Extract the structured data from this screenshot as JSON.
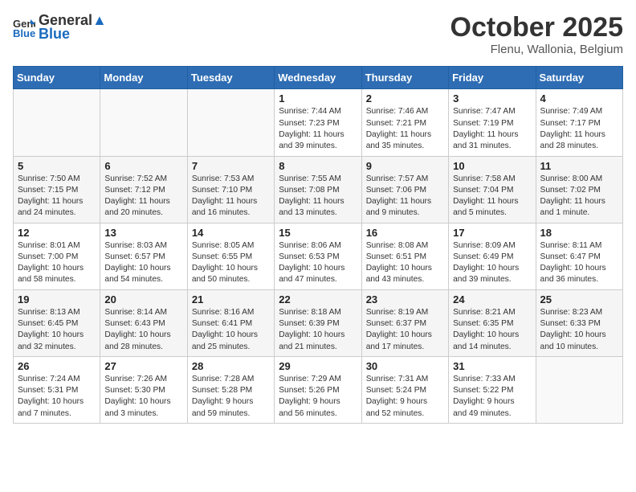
{
  "header": {
    "logo_general": "General",
    "logo_blue": "Blue",
    "month": "October 2025",
    "location": "Flenu, Wallonia, Belgium"
  },
  "weekdays": [
    "Sunday",
    "Monday",
    "Tuesday",
    "Wednesday",
    "Thursday",
    "Friday",
    "Saturday"
  ],
  "weeks": [
    [
      {
        "day": "",
        "info": ""
      },
      {
        "day": "",
        "info": ""
      },
      {
        "day": "",
        "info": ""
      },
      {
        "day": "1",
        "info": "Sunrise: 7:44 AM\nSunset: 7:23 PM\nDaylight: 11 hours\nand 39 minutes."
      },
      {
        "day": "2",
        "info": "Sunrise: 7:46 AM\nSunset: 7:21 PM\nDaylight: 11 hours\nand 35 minutes."
      },
      {
        "day": "3",
        "info": "Sunrise: 7:47 AM\nSunset: 7:19 PM\nDaylight: 11 hours\nand 31 minutes."
      },
      {
        "day": "4",
        "info": "Sunrise: 7:49 AM\nSunset: 7:17 PM\nDaylight: 11 hours\nand 28 minutes."
      }
    ],
    [
      {
        "day": "5",
        "info": "Sunrise: 7:50 AM\nSunset: 7:15 PM\nDaylight: 11 hours\nand 24 minutes."
      },
      {
        "day": "6",
        "info": "Sunrise: 7:52 AM\nSunset: 7:12 PM\nDaylight: 11 hours\nand 20 minutes."
      },
      {
        "day": "7",
        "info": "Sunrise: 7:53 AM\nSunset: 7:10 PM\nDaylight: 11 hours\nand 16 minutes."
      },
      {
        "day": "8",
        "info": "Sunrise: 7:55 AM\nSunset: 7:08 PM\nDaylight: 11 hours\nand 13 minutes."
      },
      {
        "day": "9",
        "info": "Sunrise: 7:57 AM\nSunset: 7:06 PM\nDaylight: 11 hours\nand 9 minutes."
      },
      {
        "day": "10",
        "info": "Sunrise: 7:58 AM\nSunset: 7:04 PM\nDaylight: 11 hours\nand 5 minutes."
      },
      {
        "day": "11",
        "info": "Sunrise: 8:00 AM\nSunset: 7:02 PM\nDaylight: 11 hours\nand 1 minute."
      }
    ],
    [
      {
        "day": "12",
        "info": "Sunrise: 8:01 AM\nSunset: 7:00 PM\nDaylight: 10 hours\nand 58 minutes."
      },
      {
        "day": "13",
        "info": "Sunrise: 8:03 AM\nSunset: 6:57 PM\nDaylight: 10 hours\nand 54 minutes."
      },
      {
        "day": "14",
        "info": "Sunrise: 8:05 AM\nSunset: 6:55 PM\nDaylight: 10 hours\nand 50 minutes."
      },
      {
        "day": "15",
        "info": "Sunrise: 8:06 AM\nSunset: 6:53 PM\nDaylight: 10 hours\nand 47 minutes."
      },
      {
        "day": "16",
        "info": "Sunrise: 8:08 AM\nSunset: 6:51 PM\nDaylight: 10 hours\nand 43 minutes."
      },
      {
        "day": "17",
        "info": "Sunrise: 8:09 AM\nSunset: 6:49 PM\nDaylight: 10 hours\nand 39 minutes."
      },
      {
        "day": "18",
        "info": "Sunrise: 8:11 AM\nSunset: 6:47 PM\nDaylight: 10 hours\nand 36 minutes."
      }
    ],
    [
      {
        "day": "19",
        "info": "Sunrise: 8:13 AM\nSunset: 6:45 PM\nDaylight: 10 hours\nand 32 minutes."
      },
      {
        "day": "20",
        "info": "Sunrise: 8:14 AM\nSunset: 6:43 PM\nDaylight: 10 hours\nand 28 minutes."
      },
      {
        "day": "21",
        "info": "Sunrise: 8:16 AM\nSunset: 6:41 PM\nDaylight: 10 hours\nand 25 minutes."
      },
      {
        "day": "22",
        "info": "Sunrise: 8:18 AM\nSunset: 6:39 PM\nDaylight: 10 hours\nand 21 minutes."
      },
      {
        "day": "23",
        "info": "Sunrise: 8:19 AM\nSunset: 6:37 PM\nDaylight: 10 hours\nand 17 minutes."
      },
      {
        "day": "24",
        "info": "Sunrise: 8:21 AM\nSunset: 6:35 PM\nDaylight: 10 hours\nand 14 minutes."
      },
      {
        "day": "25",
        "info": "Sunrise: 8:23 AM\nSunset: 6:33 PM\nDaylight: 10 hours\nand 10 minutes."
      }
    ],
    [
      {
        "day": "26",
        "info": "Sunrise: 7:24 AM\nSunset: 5:31 PM\nDaylight: 10 hours\nand 7 minutes."
      },
      {
        "day": "27",
        "info": "Sunrise: 7:26 AM\nSunset: 5:30 PM\nDaylight: 10 hours\nand 3 minutes."
      },
      {
        "day": "28",
        "info": "Sunrise: 7:28 AM\nSunset: 5:28 PM\nDaylight: 9 hours\nand 59 minutes."
      },
      {
        "day": "29",
        "info": "Sunrise: 7:29 AM\nSunset: 5:26 PM\nDaylight: 9 hours\nand 56 minutes."
      },
      {
        "day": "30",
        "info": "Sunrise: 7:31 AM\nSunset: 5:24 PM\nDaylight: 9 hours\nand 52 minutes."
      },
      {
        "day": "31",
        "info": "Sunrise: 7:33 AM\nSunset: 5:22 PM\nDaylight: 9 hours\nand 49 minutes."
      },
      {
        "day": "",
        "info": ""
      }
    ]
  ]
}
